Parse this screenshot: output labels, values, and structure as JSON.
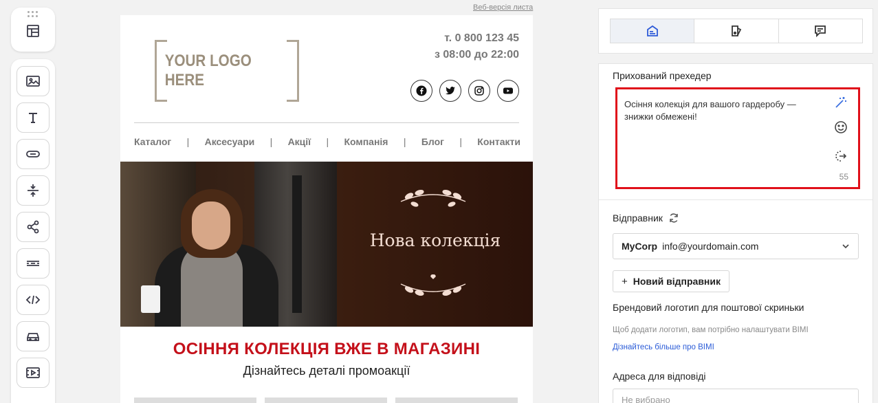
{
  "toolbar": {
    "top_icon": "layout-icon",
    "tools": [
      "image-icon",
      "text-icon",
      "button-icon",
      "spacer-icon",
      "share-icon",
      "divider-icon",
      "code-icon",
      "car-icon",
      "video-icon"
    ]
  },
  "email": {
    "web_version_link": "Веб-версія листа",
    "logo_text": "YOUR LOGO HERE",
    "phone": "т. 0 800 123 45",
    "hours": "з 08:00 до 22:00",
    "socials": [
      "facebook-icon",
      "twitter-icon",
      "instagram-icon",
      "youtube-icon"
    ],
    "nav": [
      "Каталог",
      "Аксесуари",
      "Акції",
      "Компанія",
      "Блог",
      "Контакти"
    ],
    "hero_title": "Нова колекція",
    "headline": "ОСІННЯ КОЛЕКЦІЯ ВЖЕ В МАГАЗИНІ",
    "subline": "Дізнайтесь деталі промоакції"
  },
  "panel": {
    "tabs": [
      {
        "icon": "email-settings-icon",
        "active": true
      },
      {
        "icon": "style-icon",
        "active": false
      },
      {
        "icon": "comment-icon",
        "active": false
      }
    ],
    "preheader_label": "Прихований прехедер",
    "preheader_text": "Осіння колекція для вашого гардеробу — знижки обмежені!",
    "preheader_count": "55",
    "sender_label": "Відправник",
    "sender_name": "MyCorp",
    "sender_email": "info@yourdomain.com",
    "new_sender_button": "Новий відправник",
    "brand_logo_title": "Брендовий логотип для поштової скриньки",
    "bimi_hint": "Щоб додати логотип, вам потрібно налаштувати BIMI",
    "bimi_link": "Дізнайтесь більше про BIMI",
    "reply_title": "Адреса для відповіді",
    "reply_placeholder": "Не вибрано"
  },
  "colors": {
    "accent": "#2d5ad8",
    "highlight": "#e0101a",
    "headline": "#c4101a"
  }
}
